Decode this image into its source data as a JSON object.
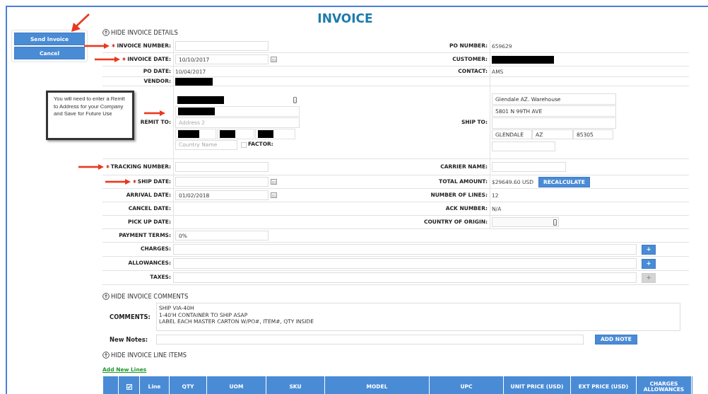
{
  "title": "INVOICE",
  "actions": [
    {
      "label": "Send Invoice",
      "arrow": true
    },
    {
      "label": "Cancel",
      "arrow": false
    }
  ],
  "callout": "You will need to enter a Remit to Address for your Company and Save for Future Use",
  "details_toggle": "HIDE INVOICE DETAILS",
  "detail_rows": [
    {
      "left": {
        "label": "INVOICE NUMBER:",
        "kind": "input",
        "required": true,
        "arrow": true
      },
      "right": {
        "label": "PO NUMBER:",
        "kind": "text",
        "value": "659629"
      }
    },
    {
      "left": {
        "label": "INVOICE DATE:",
        "kind": "date",
        "value": "10/10/2017",
        "required": true,
        "arrow": true
      },
      "right": {
        "label": "CUSTOMER:",
        "kind": "redacted"
      }
    },
    {
      "left": {
        "label": "PO DATE:",
        "kind": "text",
        "value": "10/04/2017"
      },
      "right": {
        "label": "CONTACT:",
        "kind": "text",
        "value": "AMS"
      }
    },
    {
      "left": {
        "label": "VENDOR:",
        "kind": "redacted"
      },
      "right": {
        "kind": "empty"
      }
    },
    {
      "left": {
        "label": "REMIT TO:",
        "kind": "remit",
        "arrow": true,
        "address2_placeholder": "Address 2",
        "country_placeholder": "Country Name",
        "factor": {
          "label": "FACTOR:",
          "checked": false
        }
      },
      "right": {
        "label": "SHIP TO:",
        "kind": "ship_to",
        "address": [
          "Glendale AZ. Warehouse",
          "5801 N 99TH AVE"
        ],
        "city": "GLENDALE",
        "state": "AZ",
        "zip": "85305"
      }
    },
    {
      "left": {
        "label": "TRACKING NUMBER:",
        "kind": "input",
        "required": true,
        "arrow": true
      },
      "right": {
        "label": "CARRIER NAME:",
        "kind": "input"
      }
    },
    {
      "left": {
        "label": "SHIP DATE:",
        "kind": "date",
        "required": true,
        "arrow": true
      },
      "right": {
        "label": "TOTAL AMOUNT:",
        "kind": "amount",
        "value": "$29649.60 USD",
        "button": "RECALCULATE"
      }
    },
    {
      "left": {
        "label": "ARRIVAL DATE:",
        "kind": "date",
        "value": "01/02/2018"
      },
      "right": {
        "label": "NUMBER OF LINES:",
        "kind": "text",
        "value": "12"
      }
    },
    {
      "left": {
        "label": "CANCEL DATE:",
        "kind": "text"
      },
      "right": {
        "label": "ACK NUMBER:",
        "kind": "text",
        "value": "N/A"
      }
    },
    {
      "left": {
        "label": "PICK UP DATE:",
        "kind": "text"
      },
      "right": {
        "label": "COUNTRY OF ORIGIN:",
        "kind": "select"
      }
    },
    {
      "left": {
        "label": "PAYMENT TERMS:",
        "kind": "input",
        "value": "0%"
      }
    }
  ],
  "adjustments": [
    {
      "label": "CHARGES:",
      "button": "+",
      "disabled": false
    },
    {
      "label": "ALLOWANCES:",
      "button": "+",
      "disabled": false
    },
    {
      "label": "TAXES:",
      "button": "+",
      "disabled": true
    }
  ],
  "comments_toggle": "HIDE INVOICE COMMENTS",
  "comments": {
    "label": "COMMENTS:",
    "value": "SHIP VIA-40H\n1-40'H CONTAINER TO SHIP ASAP\nLABEL EACH MASTER CARTON W/PO#, ITEM#, QTY INSIDE"
  },
  "new_notes": {
    "label": "New Notes:",
    "button": "ADD NOTE"
  },
  "lines_toggle": "HIDE INVOICE LINE ITEMS",
  "add_lines_link": "Add New Lines",
  "table": {
    "select_all": {
      "checked": true
    },
    "columns": [
      "Line",
      "QTY",
      "UOM",
      "SKU",
      "MODEL",
      "UPC",
      "UNIT PRICE (USD)",
      "EXT PRICE (USD)",
      "CHARGES ALLOWANCES"
    ]
  }
}
